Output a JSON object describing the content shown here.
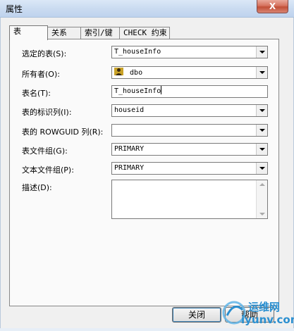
{
  "window": {
    "title": "属性",
    "close_symbol": "X"
  },
  "tabs": [
    {
      "label": "表",
      "active": true
    },
    {
      "label": "关系",
      "active": false
    },
    {
      "label": "索引/键",
      "active": false
    },
    {
      "label": "CHECK 约束",
      "active": false
    }
  ],
  "fields": {
    "selected_table": {
      "label": "选定的表(S):",
      "value": "T_houseInfo"
    },
    "owner": {
      "label": "所有者(O):",
      "value": "dbo"
    },
    "table_name": {
      "label": "表名(T):",
      "value": "T_houseInfo"
    },
    "identity_column": {
      "label": "表的标识列(I):",
      "value": "houseid"
    },
    "rowguid_column": {
      "label": "表的 ROWGUID 列(R):",
      "value": ""
    },
    "table_filegroup": {
      "label": "表文件组(G):",
      "value": "PRIMARY"
    },
    "text_filegroup": {
      "label": "文本文件组(P):",
      "value": "PRIMARY"
    },
    "description": {
      "label": "描述(D):",
      "value": ""
    }
  },
  "buttons": {
    "close": "关闭",
    "help": "帮助"
  },
  "watermark": {
    "text": "运维网",
    "url_text": "iyunv.com"
  },
  "colors": {
    "titlebar": "#c9daf0",
    "close_button": "#c14f37",
    "dialog_bg": "#f0f0f0",
    "watermark_blue": "#2a8fd0"
  }
}
